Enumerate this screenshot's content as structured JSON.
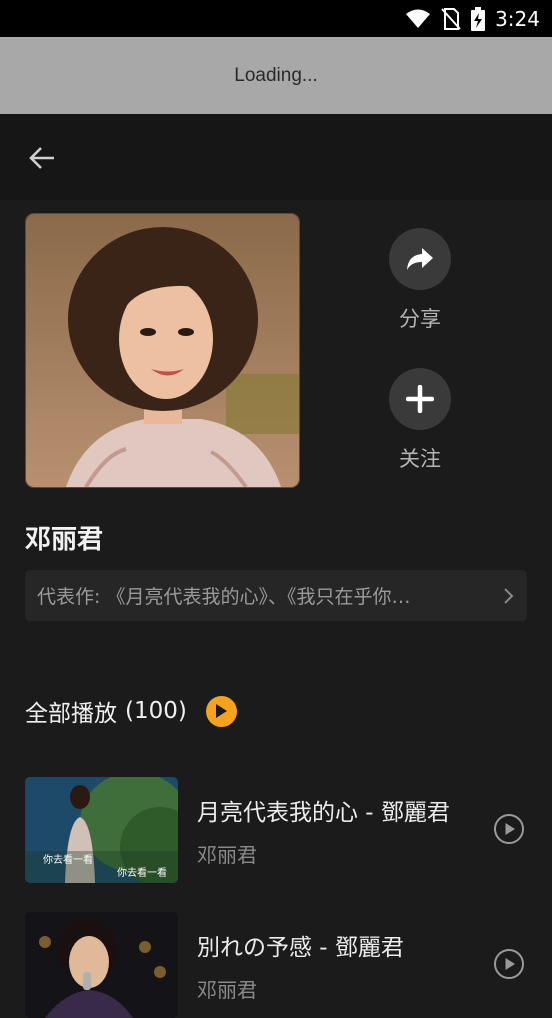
{
  "status_bar": {
    "time": "3:24"
  },
  "loading": {
    "text": "Loading..."
  },
  "actions": {
    "share_label": "分享",
    "follow_label": "关注"
  },
  "artist": {
    "name": "邓丽君",
    "works_text": "代表作: 《月亮代表我的心》、《我只在乎你…"
  },
  "play_all": {
    "label": "全部播放",
    "count": "(100)"
  },
  "songs": [
    {
      "title": "月亮代表我的心 - 鄧麗君",
      "artist": "邓丽君",
      "thumb_caption_left": "你去看一看",
      "thumb_caption_right": "你去看一看"
    },
    {
      "title": "別れの予感 - 鄧麗君",
      "artist": "邓丽君"
    }
  ],
  "colors": {
    "accent": "#f7a21b",
    "background": "#1b1b1b",
    "loading_bg": "#a8a8a8"
  }
}
